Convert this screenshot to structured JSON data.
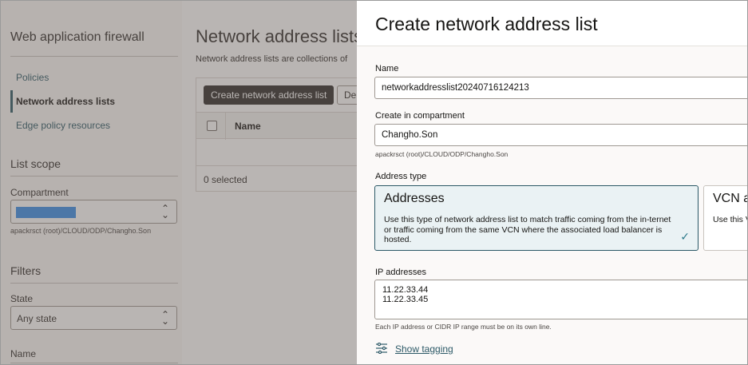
{
  "sidebar": {
    "title": "Web application firewall",
    "nav": [
      {
        "label": "Policies"
      },
      {
        "label": "Network address lists"
      },
      {
        "label": "Edge policy resources"
      }
    ],
    "list_scope_heading": "List scope",
    "compartment_label": "Compartment",
    "compartment_path": "apackrsct (root)/CLOUD/ODP/Changho.Son",
    "filters_heading": "Filters",
    "state_label": "State",
    "state_value": "Any state",
    "name_label": "Name"
  },
  "main": {
    "title": "Network address lists",
    "description": "Network address lists are collections of",
    "create_button": "Create network address list",
    "other_button": "De",
    "column_name": "Name",
    "selected_count": "0 selected"
  },
  "drawer": {
    "title": "Create network address list",
    "name_label": "Name",
    "name_value": "networkaddresslist20240716124213",
    "compartment_label": "Create in compartment",
    "compartment_value": "Changho.Son",
    "compartment_path": "apackrsct (root)/CLOUD/ODP/Changho.Son",
    "address_type_label": "Address type",
    "cards": [
      {
        "title": "Addresses",
        "description": "Use this type of network address list to match traffic coming from the in-ternet or traffic coming from the same VCN where the associated load balancer is hosted."
      },
      {
        "title": "VCN a",
        "description": "Use this VCNs th"
      }
    ],
    "ip_label": "IP addresses",
    "ip_lines": [
      "11.22.33.44",
      "11.22.33.45"
    ],
    "ip_help": "Each IP address or CIDR IP range must be on its own line.",
    "show_tagging": "Show tagging"
  },
  "colors": {
    "accent": "#2c5967",
    "primary_button": "#312d2a",
    "selected_card_bg": "#eaf2f4",
    "redaction": "#3a8eea"
  }
}
